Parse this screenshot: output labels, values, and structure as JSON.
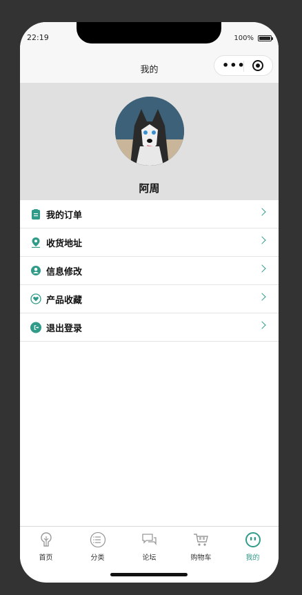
{
  "status": {
    "time": "22:19",
    "battery": "100%"
  },
  "nav": {
    "title": "我的"
  },
  "profile": {
    "name": "阿周"
  },
  "menu": [
    {
      "label": "我的订单",
      "icon": "clipboard-icon"
    },
    {
      "label": "收货地址",
      "icon": "location-pin-icon"
    },
    {
      "label": "信息修改",
      "icon": "user-icon"
    },
    {
      "label": "产品收藏",
      "icon": "heart-icon"
    },
    {
      "label": "退出登录",
      "icon": "logout-icon"
    }
  ],
  "tabs": [
    {
      "label": "首页",
      "icon": "home-icon"
    },
    {
      "label": "分类",
      "icon": "category-icon"
    },
    {
      "label": "论坛",
      "icon": "chat-icon"
    },
    {
      "label": "购物车",
      "icon": "cart-icon"
    },
    {
      "label": "我的",
      "icon": "profile-icon",
      "active": true
    }
  ],
  "colors": {
    "accent": "#2f9b88",
    "header_bg": "#e0e0e0",
    "page_bg": "#333333"
  }
}
